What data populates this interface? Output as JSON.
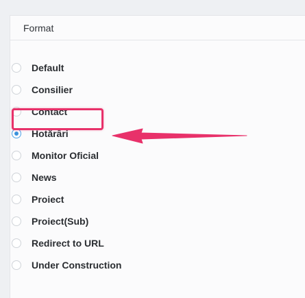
{
  "panel": {
    "header": "Format"
  },
  "options": [
    {
      "label": "Default",
      "checked": false
    },
    {
      "label": "Consilier",
      "checked": false
    },
    {
      "label": "Contact",
      "checked": false
    },
    {
      "label": "Hotărâri",
      "checked": true
    },
    {
      "label": "Monitor Oficial",
      "checked": false
    },
    {
      "label": "News",
      "checked": false
    },
    {
      "label": "Proiect",
      "checked": false
    },
    {
      "label": "Proiect(Sub)",
      "checked": false
    },
    {
      "label": "Redirect to URL",
      "checked": false
    },
    {
      "label": "Under Construction",
      "checked": false
    }
  ],
  "colors": {
    "accent": "#3b92dc",
    "annotation": "#e8316a"
  }
}
